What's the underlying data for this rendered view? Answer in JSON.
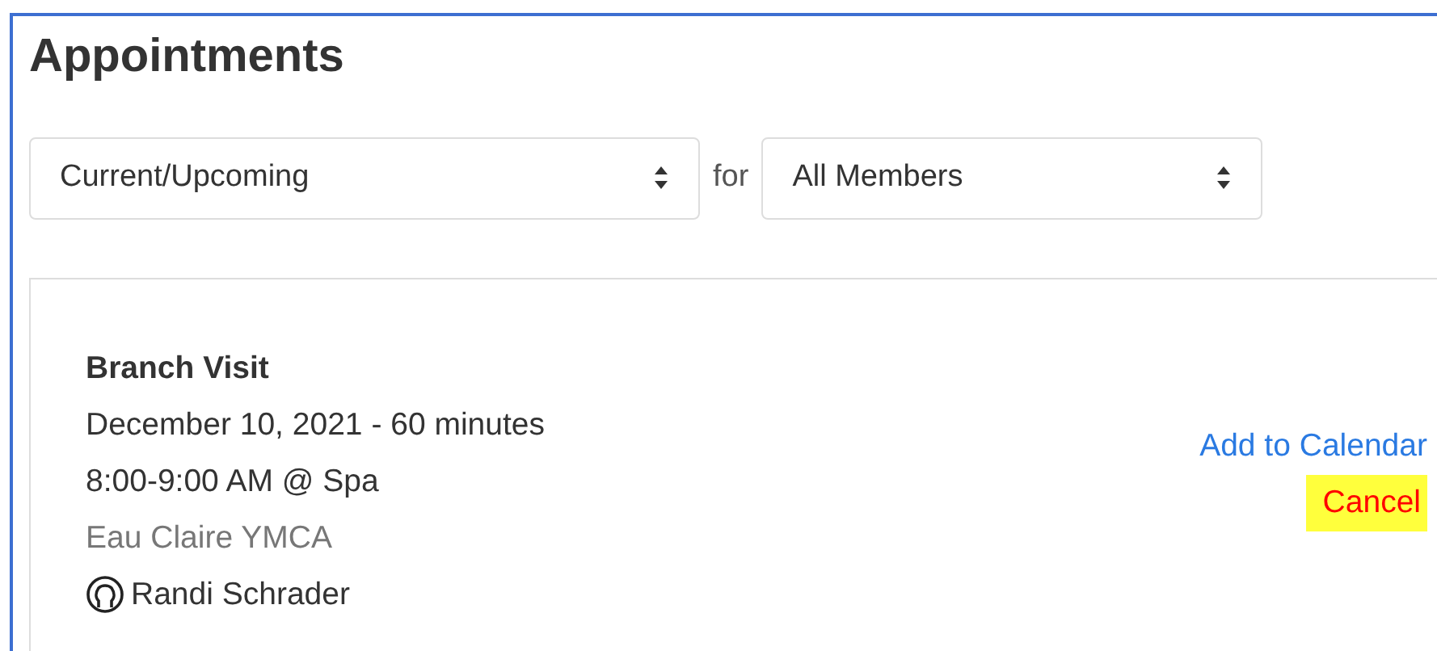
{
  "title": "Appointments",
  "filters": {
    "period": "Current/Upcoming",
    "joiner": "for",
    "member": "All Members"
  },
  "appointments": [
    {
      "name": "Branch Visit",
      "date": "December 10, 2021 - 60 minutes",
      "time": "8:00-9:00 AM @ Spa",
      "location": "Eau Claire YMCA",
      "person": "Randi Schrader",
      "actions": [
        {
          "kind": "link",
          "label": "Add to Calendar",
          "highlighted": false
        },
        {
          "kind": "danger",
          "label": "Cancel",
          "highlighted": true
        }
      ]
    }
  ]
}
